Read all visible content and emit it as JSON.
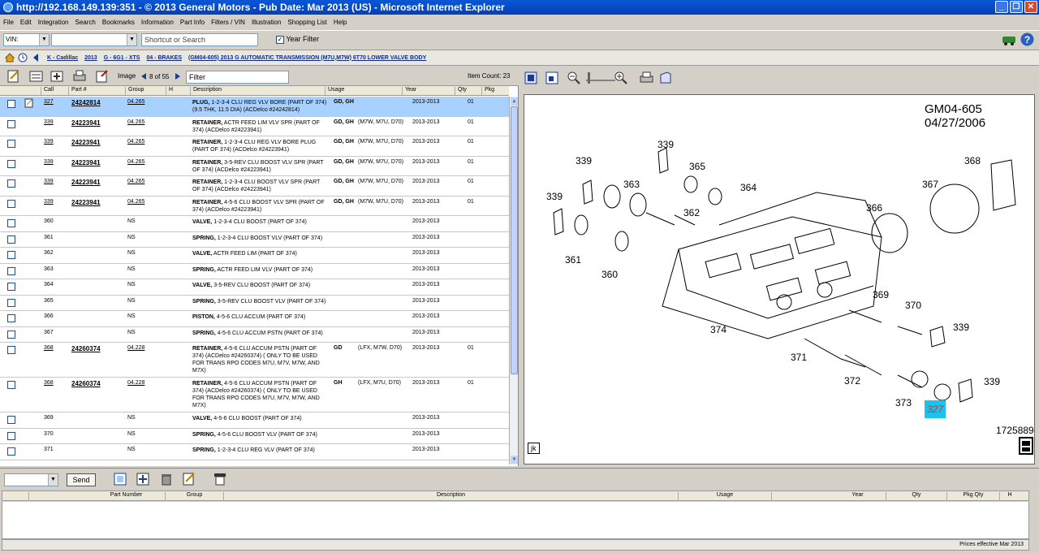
{
  "window": {
    "title": "http://192.168.149.139:351 - © 2013 General Motors - Pub Date: Mar 2013 (US) - Microsoft Internet Explorer"
  },
  "menu": [
    "File",
    "Edit",
    "Integration",
    "Search",
    "Bookmarks",
    "Information",
    "Part Info",
    "Filters / VIN",
    "Illustration",
    "Shopping List",
    "Help"
  ],
  "toolbar": {
    "vin_label": "VIN:",
    "search_placeholder": "Shortcut or Search",
    "year_filter": "Year Filter"
  },
  "breadcrumb": [
    "K - Cadillac",
    "2013",
    "G - 6G1 - XTS",
    "04 - BRAKES",
    "(GM04-605) 2013 G AUTOMATIC TRANSMISSION (M7U,M7W) 6T70 LOWER VALVE BODY"
  ],
  "list_toolbar": {
    "image_label": "Image",
    "image_pos": "8 of 55",
    "filter": "Filter",
    "item_count": "Item Count: 23"
  },
  "columns": [
    "Call",
    "Part #",
    "Group",
    "H",
    "Description",
    "Usage",
    "Year",
    "Qty",
    "Pkg"
  ],
  "rows": [
    {
      "call": "327",
      "part": "24242814",
      "group": "04.265",
      "name": "PLUG,",
      "desc": "1-2-3-4 CLU REG VLV BORE (PART OF 374) (9.5 THK, 11.5 DIA) (ACDelco #24242814)",
      "usage": "GD, GH",
      "usage2": "",
      "year": "2013-2013",
      "qty": "01",
      "selected": true
    },
    {
      "call": "339",
      "part": "24223941",
      "group": "04.265",
      "name": "RETAINER,",
      "desc": "ACTR FEED LIM VLV SPR (PART OF 374) (ACDelco #24223941)",
      "usage": "GD, GH",
      "usage2": "(M7W, M7U, D70)",
      "year": "2013-2013",
      "qty": "01"
    },
    {
      "call": "339",
      "part": "24223941",
      "group": "04.265",
      "name": "RETAINER,",
      "desc": "1-2-3-4 CLU REG VLV BORE PLUG (PART OF 374) (ACDelco #24223941)",
      "usage": "GD, GH",
      "usage2": "(M7W, M7U, D70)",
      "year": "2013-2013",
      "qty": "01"
    },
    {
      "call": "339",
      "part": "24223941",
      "group": "04.265",
      "name": "RETAINER,",
      "desc": "3-5-REV CLU BOOST VLV SPR (PART OF 374) (ACDelco #24223941)",
      "usage": "GD, GH",
      "usage2": "(M7W, M7U, D70)",
      "year": "2013-2013",
      "qty": "01"
    },
    {
      "call": "339",
      "part": "24223941",
      "group": "04.265",
      "name": "RETAINER,",
      "desc": "1-2-3-4 CLU BOOST VLV SPR (PART OF 374) (ACDelco #24223941)",
      "usage": "GD, GH",
      "usage2": "(M7W, M7U, D70)",
      "year": "2013-2013",
      "qty": "01"
    },
    {
      "call": "339",
      "part": "24223941",
      "group": "04.265",
      "name": "RETAINER,",
      "desc": "4-5-6 CLU BOOST VLV SPR (PART OF 374) (ACDelco #24223941)",
      "usage": "GD, GH",
      "usage2": "(M7W, M7U, D70)",
      "year": "2013-2013",
      "qty": "01"
    },
    {
      "call": "360",
      "part": "",
      "group": "NS",
      "name": "VALVE,",
      "desc": "1-2-3-4 CLU BOOST (PART OF 374)",
      "usage": "",
      "usage2": "",
      "year": "2013-2013",
      "qty": ""
    },
    {
      "call": "361",
      "part": "",
      "group": "NS",
      "name": "SPRING,",
      "desc": "1-2-3-4 CLU BOOST VLV (PART OF 374)",
      "usage": "",
      "usage2": "",
      "year": "2013-2013",
      "qty": ""
    },
    {
      "call": "362",
      "part": "",
      "group": "NS",
      "name": "VALVE,",
      "desc": "ACTR FEED LIM (PART OF 374)",
      "usage": "",
      "usage2": "",
      "year": "2013-2013",
      "qty": ""
    },
    {
      "call": "363",
      "part": "",
      "group": "NS",
      "name": "SPRING,",
      "desc": "ACTR FEED LIM VLV (PART OF 374)",
      "usage": "",
      "usage2": "",
      "year": "2013-2013",
      "qty": ""
    },
    {
      "call": "364",
      "part": "",
      "group": "NS",
      "name": "VALVE,",
      "desc": "3-5-REV CLU BOOST (PART OF 374)",
      "usage": "",
      "usage2": "",
      "year": "2013-2013",
      "qty": ""
    },
    {
      "call": "365",
      "part": "",
      "group": "NS",
      "name": "SPRING,",
      "desc": "3-5-REV CLU BOOST VLV (PART OF 374)",
      "usage": "",
      "usage2": "",
      "year": "2013-2013",
      "qty": ""
    },
    {
      "call": "366",
      "part": "",
      "group": "NS",
      "name": "PISTON,",
      "desc": "4-5-6 CLU ACCUM (PART OF 374)",
      "usage": "",
      "usage2": "",
      "year": "2013-2013",
      "qty": ""
    },
    {
      "call": "367",
      "part": "",
      "group": "NS",
      "name": "SPRING,",
      "desc": "4-5-6 CLU ACCUM PSTN (PART OF 374)",
      "usage": "",
      "usage2": "",
      "year": "2013-2013",
      "qty": ""
    },
    {
      "call": "368",
      "part": "24260374",
      "group": "04.228",
      "name": "RETAINER,",
      "desc": "4-5-6 CLU ACCUM PSTN (PART OF 374) (ACDelco #24260374) ( ONLY TO BE USED FOR TRANS RPO CODES M7U, M7V, M7W, AND M7X)",
      "usage": "GD",
      "usage2": "(LFX, M7W, D70)",
      "year": "2013-2013",
      "qty": "01"
    },
    {
      "call": "368",
      "part": "24260374",
      "group": "04.228",
      "name": "RETAINER,",
      "desc": "4-5-6 CLU ACCUM PSTN (PART OF 374) (ACDelco #24260374) ( ONLY TO BE USED FOR TRANS RPO CODES M7U, M7V, M7W, AND M7X)",
      "usage": "GH",
      "usage2": "(LFX, M7U, D70)",
      "year": "2013-2013",
      "qty": "01"
    },
    {
      "call": "369",
      "part": "",
      "group": "NS",
      "name": "VALVE,",
      "desc": "4-5-6 CLU BOOST (PART OF 374)",
      "usage": "",
      "usage2": "",
      "year": "2013-2013",
      "qty": ""
    },
    {
      "call": "370",
      "part": "",
      "group": "NS",
      "name": "SPRING,",
      "desc": "4-5-6 CLU BOOST VLV (PART OF 374)",
      "usage": "",
      "usage2": "",
      "year": "2013-2013",
      "qty": ""
    },
    {
      "call": "371",
      "part": "",
      "group": "NS",
      "name": "SPRING,",
      "desc": "1-2-3-4 CLU REG VLV (PART OF 374)",
      "usage": "",
      "usage2": "",
      "year": "2013-2013",
      "qty": ""
    }
  ],
  "diagram": {
    "header": "GM04-605  04/27/2006",
    "footer": "1725889",
    "corner": "jk",
    "highlight": "327",
    "callouts": [
      "339",
      "339",
      "365",
      "339",
      "363",
      "364",
      "368",
      "367",
      "362",
      "366",
      "361",
      "360",
      "369",
      "370",
      "339",
      "374",
      "371",
      "372",
      "373",
      "327",
      "339"
    ]
  },
  "bottom": {
    "send": "Send",
    "columns": [
      "Part Number",
      "Group",
      "Description",
      "Usage",
      "Year",
      "Qty",
      "Pkg Qty",
      "H"
    ],
    "status": "Prices effective Mar 2013"
  }
}
